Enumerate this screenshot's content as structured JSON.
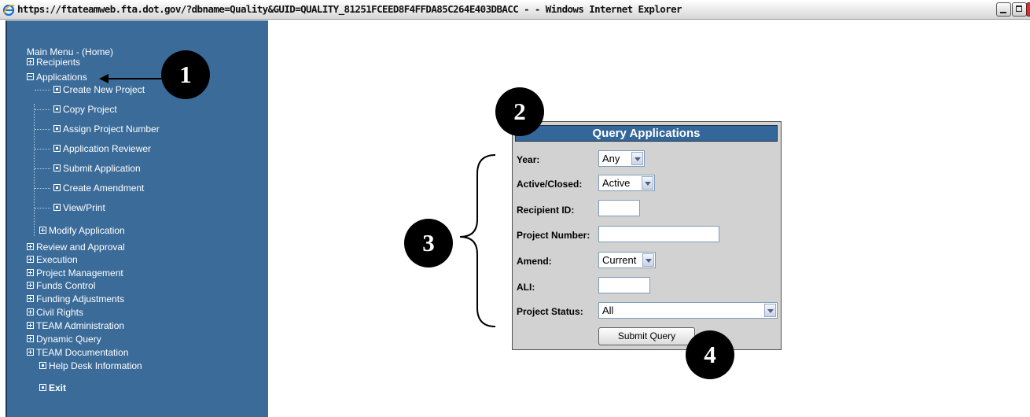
{
  "window": {
    "title": "https://ftateamweb.fta.dot.gov/?dbname=Quality&GUID=QUALITY_81251FCEED8F4FFDA85C264E403DBACC - - Windows Internet Explorer",
    "icon": "ie-icon"
  },
  "sidebar": {
    "main_menu": "Main Menu - (Home)",
    "recipients": "Recipients",
    "applications": "Applications",
    "app_items": [
      "Create New Project",
      "Copy Project",
      "Assign Project Number",
      "Application Reviewer",
      "Submit Application",
      "Create Amendment",
      "View/Print"
    ],
    "modify_application": "Modify Application",
    "sections": [
      "Review and Approval",
      "Execution",
      "Project Management",
      "Funds Control",
      "Funding Adjustments",
      "Civil Rights",
      "TEAM Administration",
      "Dynamic Query",
      "TEAM Documentation"
    ],
    "help_desk": "Help Desk Information",
    "exit": "Exit"
  },
  "form": {
    "title": "Query Applications",
    "year": {
      "label": "Year:",
      "value": "Any"
    },
    "active_closed": {
      "label": "Active/Closed:",
      "value": "Active"
    },
    "recipient_id": {
      "label": "Recipient ID:",
      "value": ""
    },
    "project_number": {
      "label": "Project Number:",
      "value": ""
    },
    "amend": {
      "label": "Amend:",
      "value": "Current"
    },
    "ali": {
      "label": "ALI:",
      "value": ""
    },
    "project_status": {
      "label": "Project Status:",
      "value": "All"
    },
    "submit_label": "Submit Query"
  },
  "callouts": [
    "1",
    "2",
    "3",
    "4"
  ],
  "colors": {
    "sidebar": "#3a6b99",
    "panel_header": "#336699",
    "panel": "#d2d2d2"
  }
}
